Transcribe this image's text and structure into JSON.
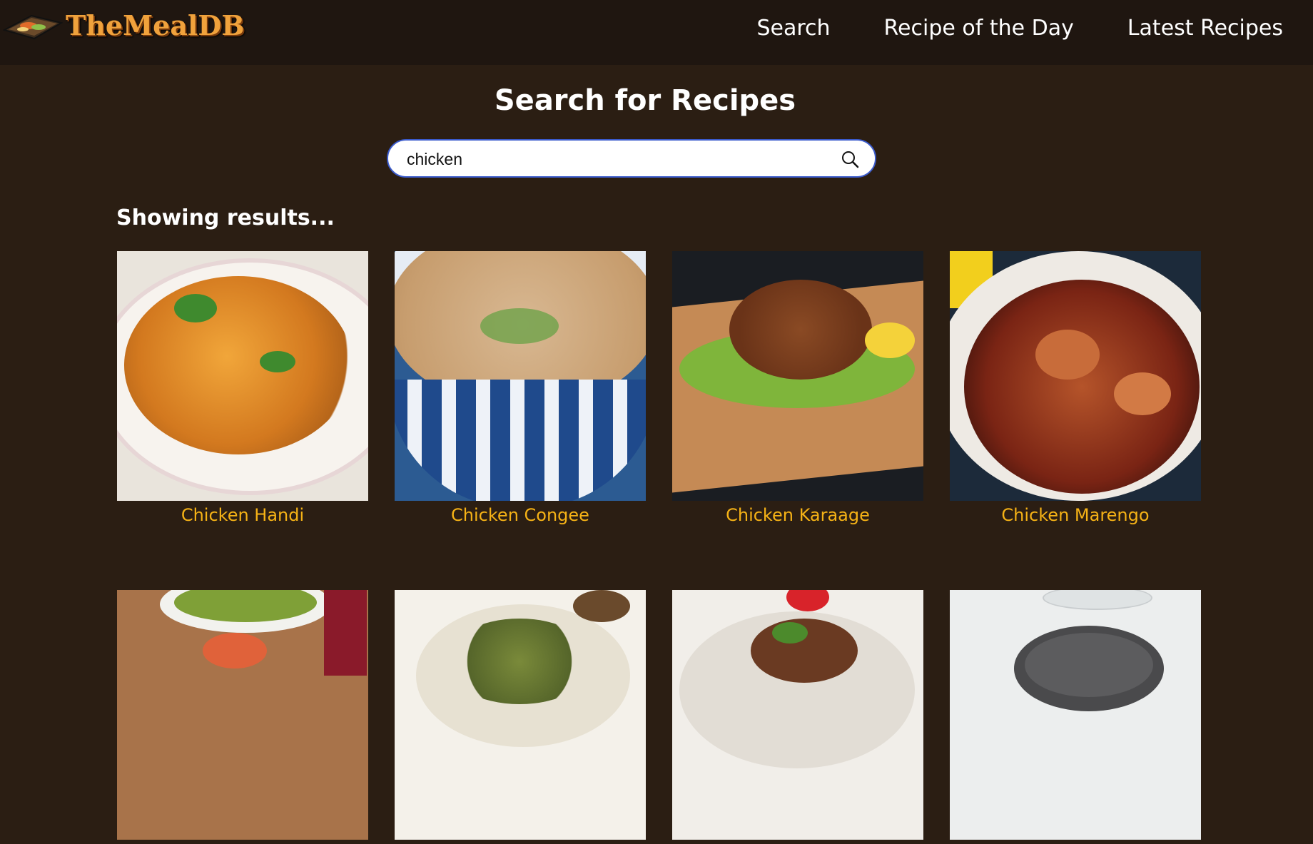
{
  "header": {
    "logo_text": "TheMealDB",
    "nav": [
      "Search",
      "Recipe of the Day",
      "Latest Recipes"
    ]
  },
  "main": {
    "title": "Search for Recipes",
    "search": {
      "value": "chicken",
      "placeholder": ""
    },
    "results_label": "Showing results..."
  },
  "results": [
    {
      "name": "Chicken Handi"
    },
    {
      "name": "Chicken Congee"
    },
    {
      "name": "Chicken Karaage"
    },
    {
      "name": "Chicken Marengo"
    },
    {
      "name": ""
    },
    {
      "name": ""
    },
    {
      "name": ""
    },
    {
      "name": ""
    }
  ],
  "colors": {
    "background": "#2b1e13",
    "navbar": "#1f1610",
    "accent_title": "#f5b216",
    "search_border": "#3b5bcc"
  }
}
